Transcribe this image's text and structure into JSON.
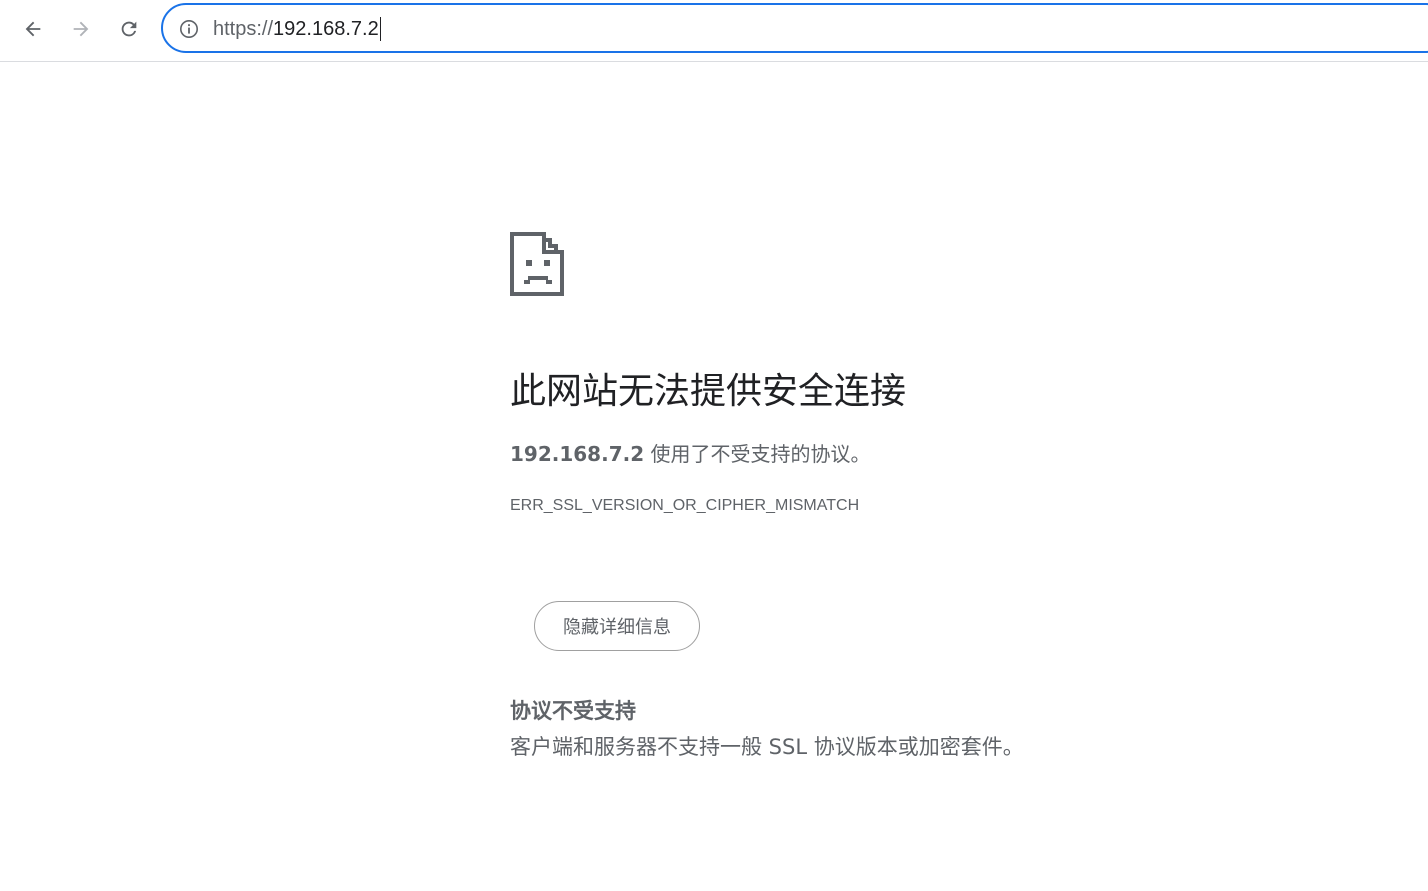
{
  "browser": {
    "url_scheme": "https://",
    "url_host": "192.168.7.2",
    "icons": {
      "back": "arrow-left-icon",
      "forward": "arrow-right-icon",
      "reload": "reload-icon",
      "site_info": "info-circle-icon"
    }
  },
  "error_page": {
    "icon": "sad-document-icon",
    "heading": "此网站无法提供安全连接",
    "host": "192.168.7.2",
    "message": "使用了不受支持的协议。",
    "error_code": "ERR_SSL_VERSION_OR_CIPHER_MISMATCH",
    "details_button_label": "隐藏详细信息",
    "details_heading": "协议不受支持",
    "details_body": "客户端和服务器不支持一般 SSL 协议版本或加密套件。"
  },
  "colors": {
    "accent": "#1a73e8",
    "text_primary": "#202124",
    "text_secondary": "#5f6368"
  }
}
